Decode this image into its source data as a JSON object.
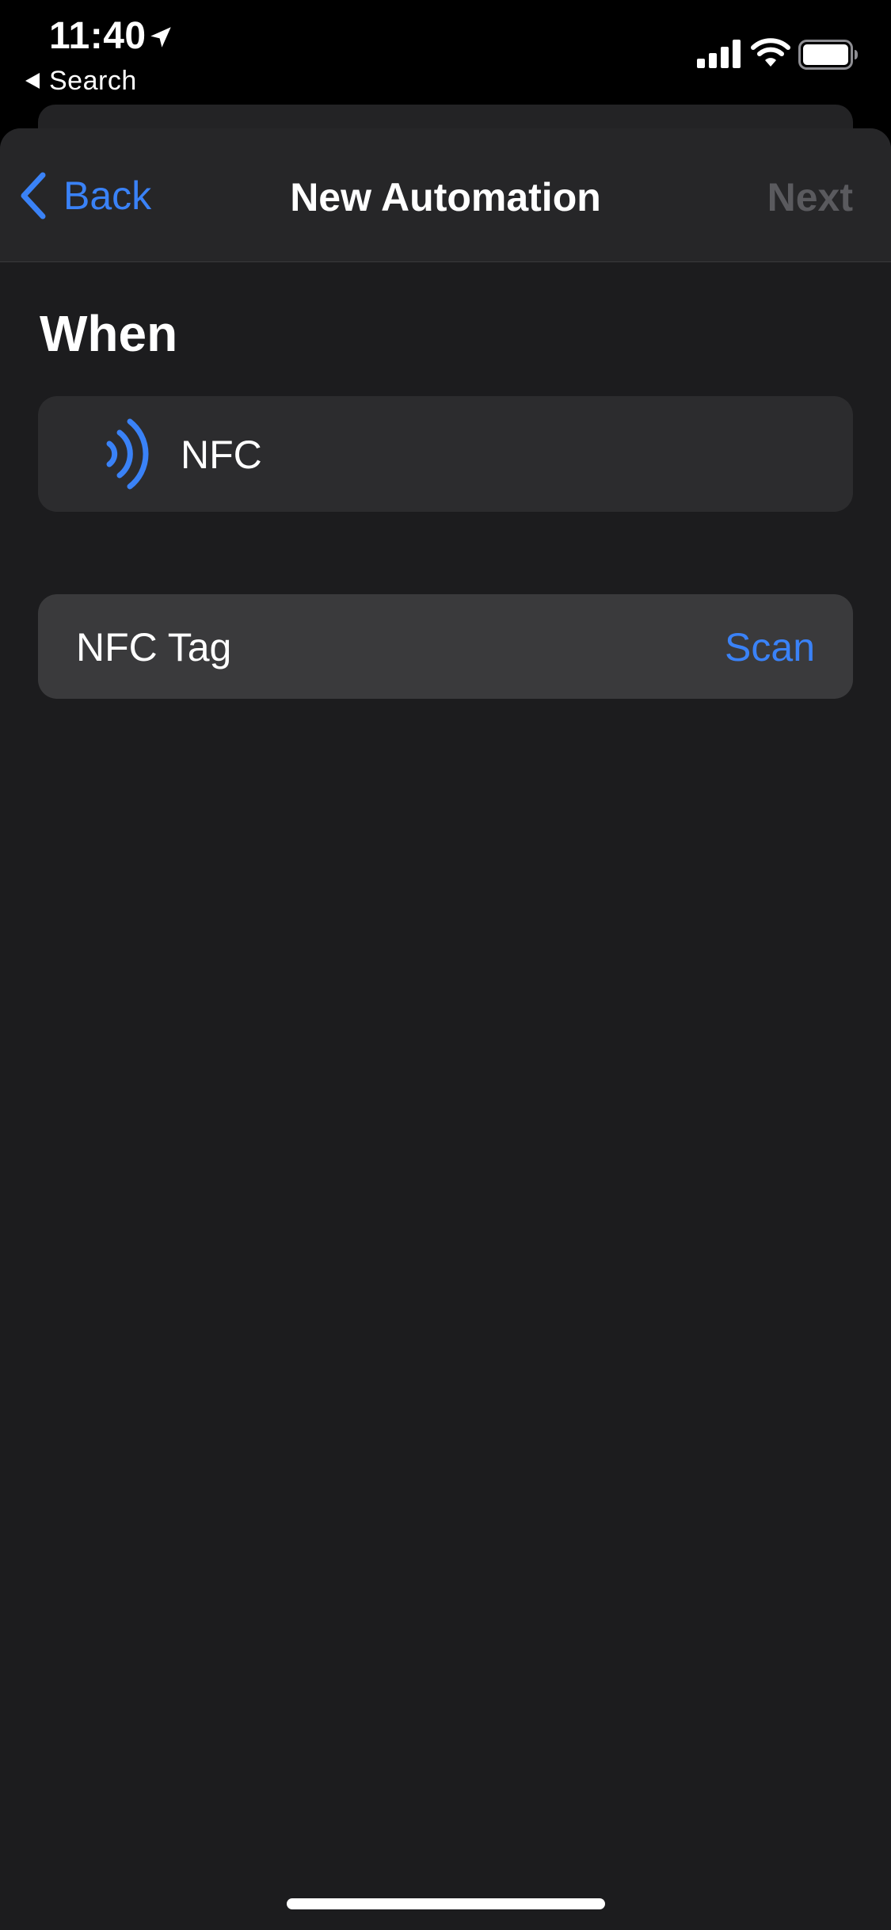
{
  "status_bar": {
    "time": "11:40",
    "back_to_app": "Search",
    "icons": [
      "location-arrow-icon",
      "cellular-signal-icon",
      "wifi-icon",
      "battery-icon"
    ]
  },
  "nav": {
    "back_label": "Back",
    "title": "New Automation",
    "next_label": "Next"
  },
  "content": {
    "section_heading": "When",
    "trigger": {
      "icon": "nfc-icon",
      "label": "NFC"
    },
    "tag_row": {
      "label": "NFC Tag",
      "action": "Scan"
    }
  },
  "colors": {
    "accent": "#3a82f7",
    "background": "#1c1c1e",
    "card": "#2c2c2e",
    "disabled": "#5a5a5e"
  }
}
